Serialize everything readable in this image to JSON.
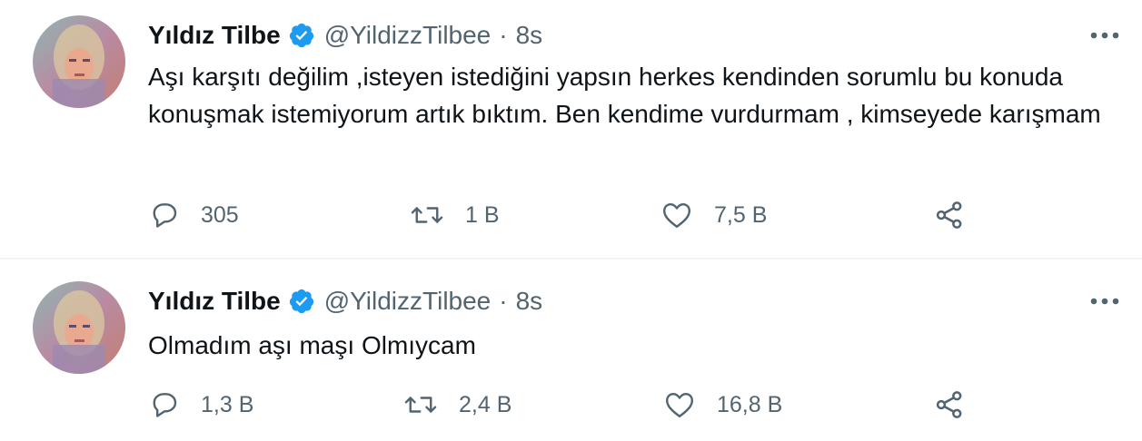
{
  "tweets": [
    {
      "author_name": "Yıldız Tilbe",
      "handle": "@YildizzTilbee",
      "separator": "·",
      "time": "8s",
      "verified": true,
      "text": "Aşı karşıtı değilim ,isteyen istediğini yapsın herkes kendinden sorumlu bu konuda konuşmak istemiyorum artık bıktım. Ben kendime vurdurmam , kimseyede karışmam",
      "replies": "305",
      "retweets": "1 B",
      "likes": "7,5 B"
    },
    {
      "author_name": "Yıldız Tilbe",
      "handle": "@YildizzTilbee",
      "separator": "·",
      "time": "8s",
      "verified": true,
      "text": "Olmadım aşı maşı Olmıycam",
      "replies": "1,3 B",
      "retweets": "2,4 B",
      "likes": "16,8 B"
    }
  ],
  "icons": {
    "reply": "reply-icon",
    "retweet": "retweet-icon",
    "like": "heart-icon",
    "share": "share-icon",
    "more": "more-icon",
    "verified": "verified-badge-icon"
  },
  "colors": {
    "verified": "#1d9bf0",
    "text": "#0f1419",
    "secondary": "#536471",
    "divider": "#eff3f4"
  }
}
